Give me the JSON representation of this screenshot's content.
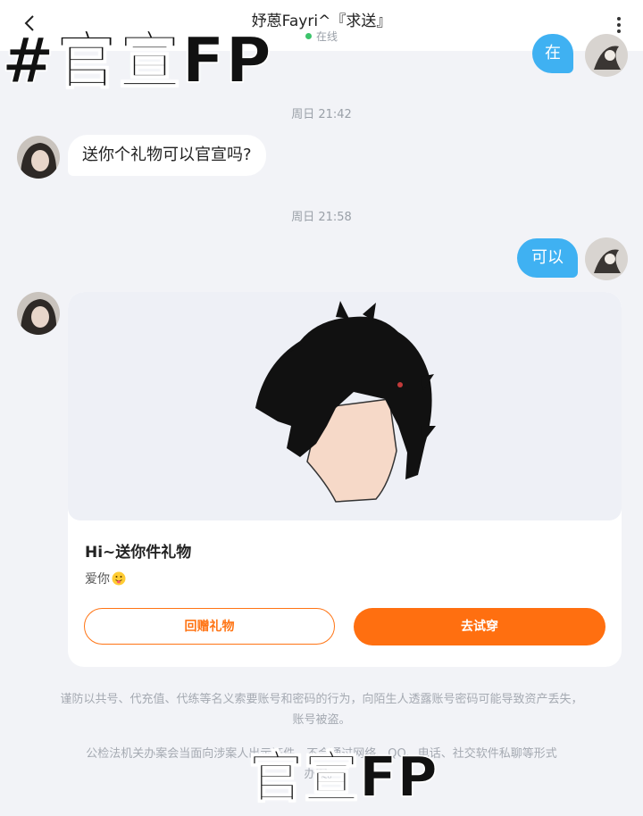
{
  "header": {
    "title": "妤蒽Fayri^『求送』",
    "status": "在线"
  },
  "messages": [
    {
      "side": "right",
      "text": "在"
    },
    {
      "time": "周日 21:42"
    },
    {
      "side": "left",
      "text": "送你个礼物可以官宣吗?"
    },
    {
      "time": "周日 21:58"
    },
    {
      "side": "right",
      "text": "可以"
    }
  ],
  "gift_card": {
    "title": "Hi~送你件礼物",
    "message": "爱你",
    "return_gift_label": "回赠礼物",
    "try_on_label": "去试穿"
  },
  "notice": {
    "line1": "谨防以共号、代充值、代练等名义索要账号和密码的行为，向陌生人透露账号密码可能导致资产丢失，",
    "line2": "账号被盗。",
    "line3": "公检法机关办案会当面向涉案人出示证件，不会通过网络、QQ、电话、社交软件私聊等形式",
    "line4": "办案。"
  },
  "overlays": {
    "top": "#官宣FP",
    "bottom": "官宣FP"
  },
  "colors": {
    "accent_orange": "#ff6f10",
    "bubble_blue": "#3fb1f2",
    "online_green": "#3cc46b"
  }
}
